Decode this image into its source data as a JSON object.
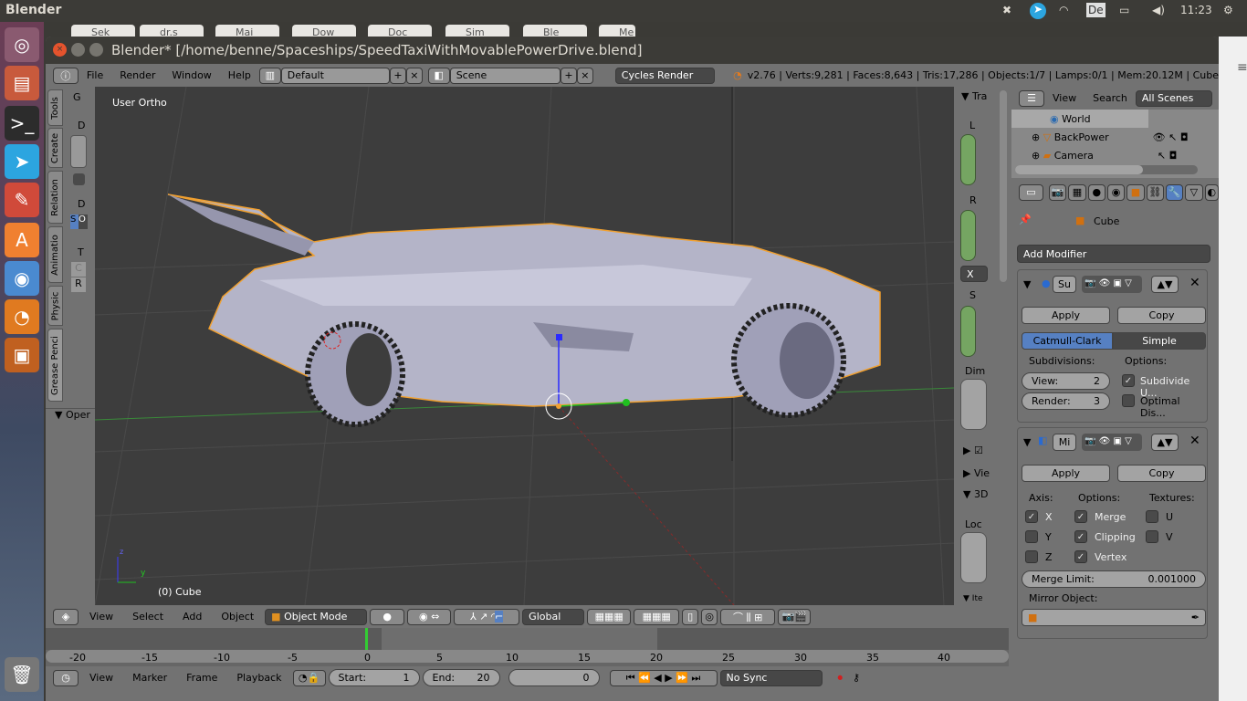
{
  "os": {
    "app_name": "Blender",
    "clock": "11:23",
    "keyboard_layout": "De",
    "launcher_icons": [
      "ubuntu-dash-icon",
      "files-icon",
      "terminal-icon",
      "telegram-icon",
      "settings-icon",
      "software-center-icon",
      "chrome-icon",
      "blender-icon",
      "impress-icon",
      "trash-icon"
    ]
  },
  "browser_tabs": [
    "Sek",
    "dr.s",
    "Mai",
    "Dow",
    "Doc",
    "Sim",
    "Ble",
    "Me"
  ],
  "window": {
    "title": "Blender* [/home/benne/Spaceships/SpeedTaxiWithMovablePowerDrive.blend]"
  },
  "info_header": {
    "menus": [
      "File",
      "Render",
      "Window",
      "Help"
    ],
    "layout": "Default",
    "scene": "Scene",
    "engine": "Cycles Render",
    "stats": "v2.76 | Verts:9,281 | Faces:8,643 | Tris:17,286 | Objects:1/7 | Lamps:0/1 | Mem:20.12M | Cube"
  },
  "tool_shelf": {
    "tabs": [
      "Tools",
      "Create",
      "Relation",
      "Animatio",
      "Physic",
      "Grease Penci"
    ],
    "panel_title": "G",
    "labels": [
      "D",
      "D",
      "T"
    ],
    "s_btn": "S",
    "o_btn": "O",
    "c_btn": "C",
    "r_btn": "R",
    "operator": "Oper"
  },
  "viewport": {
    "view_name": "User Ortho",
    "object_label": "(0) Cube",
    "axis_x": "y",
    "axis_z": "z"
  },
  "n_panel": {
    "title": "Tra",
    "l": "L",
    "r": "R",
    "rot_mode": "X",
    "s": "S",
    "dim": "Dim",
    "vie": "Vie",
    "d3": "3D",
    "loc": "Loc",
    "ite": "Ite"
  },
  "outliner": {
    "view": "View",
    "search": "Search",
    "filter": "All Scenes",
    "items": [
      "World",
      "BackPower",
      "Camera"
    ]
  },
  "properties": {
    "object": "Cube",
    "add_modifier": "Add Modifier",
    "subsurf": {
      "name": "Su",
      "apply": "Apply",
      "copy": "Copy",
      "catmull": "Catmull-Clark",
      "simple": "Simple",
      "subdiv_label": "Subdivisions:",
      "options_label": "Options:",
      "view_label": "View:",
      "view_val": "2",
      "render_label": "Render:",
      "render_val": "3",
      "subdivide_uvs": "Subdivide U...",
      "subdivide_uvs_checked": true,
      "optimal": "Optimal Dis...",
      "optimal_checked": false
    },
    "mirror": {
      "name": "Mi",
      "apply": "Apply",
      "copy": "Copy",
      "axis_label": "Axis:",
      "options_label": "Options:",
      "textures_label": "Textures:",
      "x": "X",
      "y": "Y",
      "z": "Z",
      "merge": "Merge",
      "clipping": "Clipping",
      "vertex": "Vertex",
      "u": "U",
      "v": "V",
      "merge_limit_label": "Merge Limit:",
      "merge_limit": "0.001000",
      "mirror_object_label": "Mirror Object:"
    }
  },
  "view3d_header": {
    "menus": [
      "View",
      "Select",
      "Add",
      "Object"
    ],
    "mode": "Object Mode",
    "orientation": "Global"
  },
  "timeline": {
    "ticks": [
      "-20",
      "-15",
      "-10",
      "-5",
      "0",
      "5",
      "10",
      "15",
      "20",
      "25",
      "30",
      "35",
      "40"
    ],
    "menus": [
      "View",
      "Marker",
      "Frame",
      "Playback"
    ],
    "start_label": "Start:",
    "start": "1",
    "end_label": "End:",
    "end": "20",
    "current": "0",
    "sync": "No Sync"
  },
  "colors": {
    "accent_blue": "#5680c2",
    "selection_orange": "#f0a030",
    "car": "#b4b4c8"
  }
}
